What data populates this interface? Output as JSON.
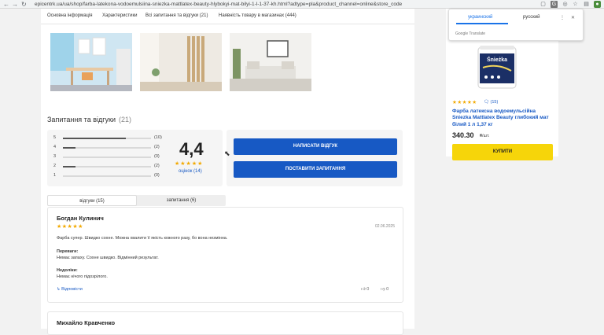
{
  "browser": {
    "url": "epicentrk.ua/ua/shop/farba-latekona-vodoemulsiina-sniezka-mattlatex-beauty-hlybokyi-mat-bilyi-1-l-1-37-kh.html?adtype=pla&product_channel=online&store_code"
  },
  "subnav": {
    "items": [
      "Основна інформація",
      "Характеристики",
      "Всі запитання та відгуки (21)",
      "Наявність товару в магазинах (444)"
    ]
  },
  "section": {
    "title": "Запитання та відгуки",
    "count": "(21)"
  },
  "rating": {
    "average": "4,4",
    "stars": "★★★★★",
    "ratings_link": "оцінок (14)",
    "distribution": [
      {
        "label": "5",
        "count": "(10)",
        "share": 0.71
      },
      {
        "label": "4",
        "count": "(2)",
        "share": 0.14
      },
      {
        "label": "3",
        "count": "(0)",
        "share": 0.0
      },
      {
        "label": "2",
        "count": "(2)",
        "share": 0.14
      },
      {
        "label": "1",
        "count": "(0)",
        "share": 0.0
      }
    ]
  },
  "actions": {
    "write_review": "НАПИСАТИ ВІДГУК",
    "ask_question": "ПОСТАВИТИ ЗАПИТАННЯ"
  },
  "tabs": {
    "reviews": "відгуки (15)",
    "questions": "запитання (6)"
  },
  "reviews": [
    {
      "author": "Богдан Кулинич",
      "stars": "★★★★★",
      "date": "02.06.2025",
      "text": "Фарба супер. Швидко сохне. Можна хвалити її якість кожного разу, бо вона незмінна.",
      "pros_label": "Переваги:",
      "pros": "Немає запаху. Сохне швидко. Відмінний результат.",
      "cons_label": "Недоліки:",
      "cons": "Немає нічого підозрілого.",
      "reply": "Відповісти",
      "likes": "0",
      "dislikes": "0"
    },
    {
      "author": "Михайло Кравченко"
    }
  ],
  "sidebar": {
    "stars": "★★★★★",
    "reviews": "(15)",
    "title": "Фарба латексна водоемульсійна Sniezka Mattlatex Beauty глибокий мат білий 1 л 1,37 кг",
    "price": "340.30",
    "unit": "₴/шт.",
    "buy": "КУПИТИ",
    "brand": "Śnieżka"
  },
  "translate": {
    "lang_from": "украинский",
    "lang_to": "русский",
    "brand": "Google Translate"
  },
  "colors": {
    "accent_blue": "#1759c4",
    "buy_yellow": "#f6d50a",
    "star": "#f2a900"
  }
}
